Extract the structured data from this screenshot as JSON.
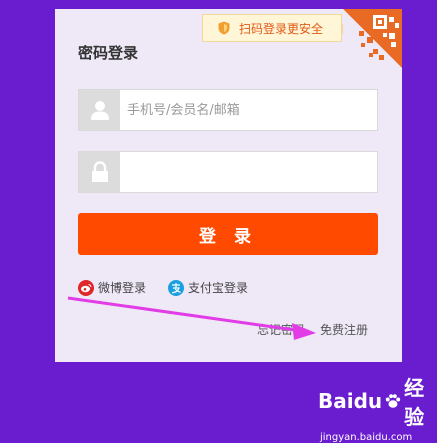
{
  "login": {
    "title": "密码登录",
    "qr_tip": "扫码登录更安全",
    "username": {
      "placeholder": "手机号/会员名/邮箱",
      "value": ""
    },
    "password": {
      "placeholder": "",
      "value": ""
    },
    "submit_label": "登 录",
    "weibo_label": "微博登录",
    "alipay_label": "支付宝登录",
    "forgot_label": "忘记密码",
    "register_label": "免费注册"
  },
  "watermark": {
    "brand": "Baidu",
    "suffix": "经验",
    "url": "jingyan.baidu.com"
  },
  "colors": {
    "background": "#6a1ccf",
    "panel": "#eee8f7",
    "primary": "#ff4a00",
    "annotation_arrow": "#e13ce6"
  },
  "icons": [
    "shield-icon",
    "qr-code-icon",
    "user-icon",
    "lock-icon",
    "weibo-icon",
    "alipay-icon",
    "paw-icon"
  ]
}
